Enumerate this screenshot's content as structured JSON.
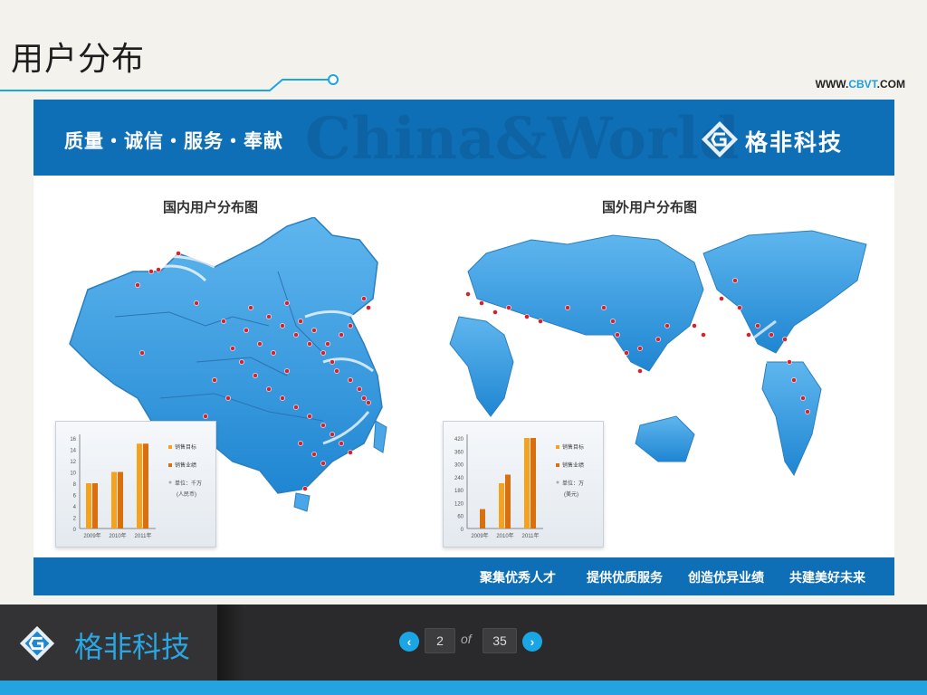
{
  "page": {
    "title": "用户分布",
    "website_prefix": "WWW.",
    "website_accent": "CBVT",
    "website_suffix": ".COM"
  },
  "banner": {
    "slogan": "质量・诚信・服务・奉献",
    "watermark": "China&World",
    "brand_name": "格非科技"
  },
  "domestic": {
    "title": "国内用户分布图",
    "chart_data": {
      "type": "bar",
      "categories": [
        "2009年",
        "2010年",
        "2011年"
      ],
      "series": [
        {
          "name": "销售目标",
          "values": [
            8,
            10,
            15
          ]
        },
        {
          "name": "销售业绩",
          "values": [
            8,
            10,
            15
          ]
        }
      ],
      "ylim": [
        0,
        16
      ],
      "yticks": [
        "0",
        "2",
        "4",
        "6",
        "8",
        "10",
        "12",
        "14",
        "16"
      ],
      "unit_line1": "单位：千万",
      "unit_line2": "(人民币)"
    }
  },
  "overseas": {
    "title": "国外用户分布图",
    "chart_data": {
      "type": "bar",
      "categories": [
        "2009年",
        "2010年",
        "2011年"
      ],
      "series": [
        {
          "name": "销售目标",
          "values": [
            0,
            210,
            420
          ]
        },
        {
          "name": "销售业绩",
          "values": [
            90,
            250,
            420
          ]
        }
      ],
      "ylim": [
        0,
        420
      ],
      "yticks": [
        "0",
        "60",
        "120",
        "180",
        "240",
        "300",
        "360",
        "420"
      ],
      "unit_line1": "单位：万",
      "unit_line2": "(美元)"
    }
  },
  "footer_items": [
    "聚集优秀人才",
    "提供优质服务",
    "创造优异业绩",
    "共建美好未来"
  ],
  "bottom_bar": {
    "brand": "格非科技",
    "current_page": "2",
    "of_label": "of",
    "total_pages": "35",
    "prev_icon": "chevron-left",
    "next_icon": "chevron-right"
  },
  "colors": {
    "brand_blue": "#0f6fb6",
    "accent": "#1aa6e5",
    "bar_primary": "#f7a21b",
    "bar_dark": "#d9700f",
    "marker": "#d8222b"
  }
}
